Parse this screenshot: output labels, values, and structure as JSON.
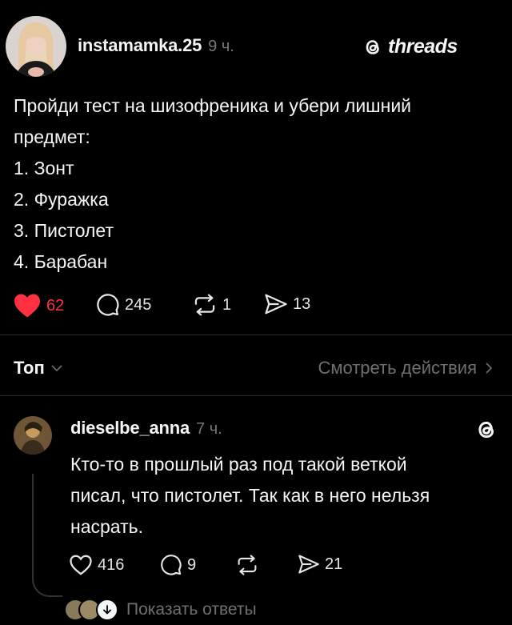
{
  "post": {
    "username": "instamamka.25",
    "time": "9 ч.",
    "brand": "threads",
    "lines": [
      "Пройди тест на шизофреника и убери лишний",
      "предмет:",
      "1. Зонт",
      "2. Фуражка",
      "3. Пистолет",
      "4. Барабан"
    ],
    "likes": "62",
    "comments": "245",
    "reposts": "1",
    "shares": "13",
    "like_color": "#ff3040"
  },
  "filter": {
    "label": "Топ",
    "activity_label": "Смотреть действия"
  },
  "reply": {
    "username": "dieselbe_anna",
    "time": "7 ч.",
    "lines": [
      "Кто-то в прошлый раз под такой веткой",
      "писал, что пистолет. Так как в него нельзя",
      "насрать."
    ],
    "likes": "416",
    "comments": "9",
    "shares": "21",
    "show_replies_label": "Показать ответы"
  },
  "icons": {
    "brand_logo": "threads-logo-icon",
    "heart": "heart-icon",
    "comment": "comment-icon",
    "repost": "repost-icon",
    "share": "share-icon"
  }
}
